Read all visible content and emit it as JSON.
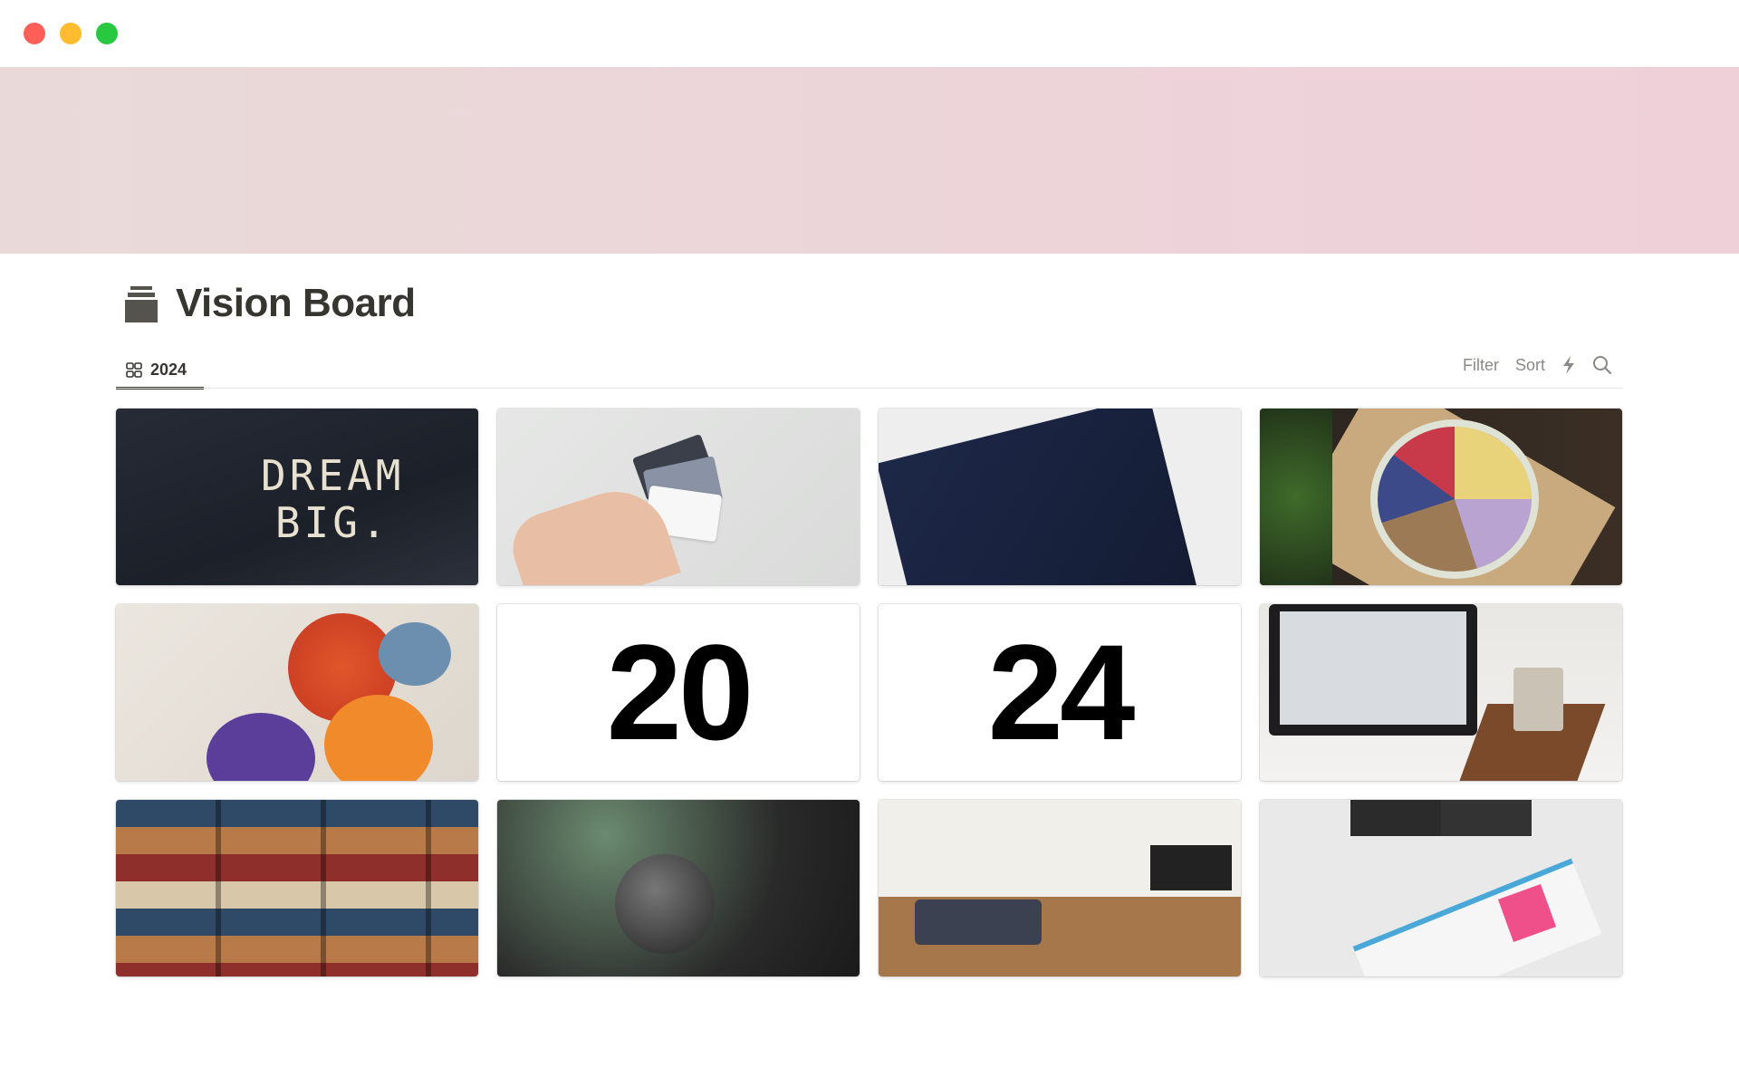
{
  "window": {
    "controls": {
      "close_color": "#ff5f57",
      "minimize_color": "#febc2e",
      "maximize_color": "#28c840"
    }
  },
  "cover": {
    "colors": [
      "#e9dad9",
      "#efd0d9"
    ]
  },
  "page": {
    "icon": "archive-box-icon",
    "title": "Vision Board"
  },
  "view_tab": {
    "icon": "gallery-grid-icon",
    "label": "2024"
  },
  "toolbar": {
    "filter_label": "Filter",
    "sort_label": "Sort",
    "automation_icon": "lightning-icon",
    "search_icon": "search-icon"
  },
  "gallery": {
    "cards": [
      {
        "type": "photo",
        "subject": "dream-big-chalkboard",
        "lettering": "DREAM BIG."
      },
      {
        "type": "photo",
        "subject": "credit-cards"
      },
      {
        "type": "photo",
        "subject": "passport"
      },
      {
        "type": "photo",
        "subject": "healthy-bowl"
      },
      {
        "type": "photo",
        "subject": "paint-cans"
      },
      {
        "type": "text",
        "text": "20"
      },
      {
        "type": "text",
        "text": "24"
      },
      {
        "type": "photo",
        "subject": "laptop-desk"
      },
      {
        "type": "photo",
        "subject": "suitcases"
      },
      {
        "type": "photo",
        "subject": "microphone"
      },
      {
        "type": "photo",
        "subject": "living-room"
      },
      {
        "type": "photo",
        "subject": "planner-desk"
      }
    ]
  }
}
